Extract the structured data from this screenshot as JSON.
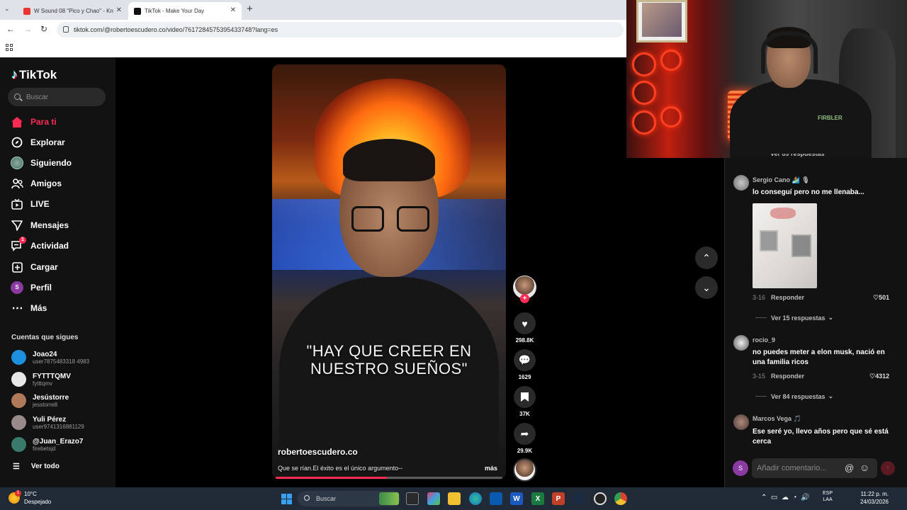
{
  "browser": {
    "tabs": [
      {
        "title": "W Sound 08 \"Pico y Chao\" - Kn"
      },
      {
        "title": "TikTok - Make Your Day"
      }
    ],
    "url": "tiktok.com/@robertoescudero.co/video/7617284575395433748?lang=es"
  },
  "sidebar": {
    "logo": "TikTok",
    "search_placeholder": "Buscar",
    "nav": [
      {
        "label": "Para ti",
        "icon": "home-icon"
      },
      {
        "label": "Explorar",
        "icon": "compass-icon"
      },
      {
        "label": "Siguiendo",
        "icon": "following-avatar-icon"
      },
      {
        "label": "Amigos",
        "icon": "friends-icon"
      },
      {
        "label": "LIVE",
        "icon": "live-icon"
      },
      {
        "label": "Mensajes",
        "icon": "messages-icon"
      },
      {
        "label": "Actividad",
        "icon": "activity-icon",
        "badge": "1"
      },
      {
        "label": "Cargar",
        "icon": "upload-icon"
      },
      {
        "label": "Perfil",
        "icon": "profile-avatar-icon"
      },
      {
        "label": "Más",
        "icon": "more-icon"
      }
    ],
    "following_title": "Cuentas que sigues",
    "accounts": [
      {
        "name": "Joao24",
        "username": "user7875483318 4983",
        "color": "#1e90e0"
      },
      {
        "name": "FYTTTQMV",
        "username": "fytttqmv",
        "color": "#e8e8e8"
      },
      {
        "name": "Jesústorre",
        "username": "jesstorre8",
        "color": "#b07a5a"
      },
      {
        "name": "Yuli Pérez",
        "username": "user9741316881129",
        "color": "#9a8a8a"
      },
      {
        "name": "@Juan_Erazo7",
        "username": "firebetsjd",
        "color": "#3a7a6a"
      }
    ],
    "see_all": "Ver todo"
  },
  "video": {
    "caption": "\"HAY QUE CREER EN NUESTRO SUEÑOS\"",
    "author": "robertoescudero.co",
    "description": "Que se rían.El éxito es el único argumento--",
    "more": "más",
    "progress": 0.49
  },
  "actions": {
    "likes": "298.8K",
    "comments": "1629",
    "saves": "37K",
    "shares": "29.9K"
  },
  "comments": {
    "cutoff_replies": "Ver 89 respuestas",
    "items": [
      {
        "user": "Sergio Cano 🏄 🎙",
        "text": "lo conseguí pero no me llenaba...",
        "date": "3-16",
        "reply": "Responder",
        "likes": "501",
        "replies": "Ver 15 respuestas"
      },
      {
        "user": "rocio_9",
        "text": "no puedes meter a elon musk, nació en una familia ricos",
        "date": "3-15",
        "reply": "Responder",
        "likes": "4312",
        "replies": "Ver 84 respuestas"
      },
      {
        "user": "Marcos Vega 🎵",
        "text": "Ese seré yo, llevo años pero que sé está cerca"
      }
    ],
    "input_placeholder": "Añadir comentario...",
    "my_avatar_letter": "S"
  },
  "webcam": {
    "shirt_text": "FIRBLER"
  },
  "taskbar": {
    "weather_temp": "10°C",
    "weather_desc": "Despejado",
    "weather_badge": "1",
    "search_placeholder": "Buscar",
    "lang_top": "ESP",
    "lang_bottom": "LAA",
    "time": "11:22 p. m.",
    "date": "24/03/2026"
  }
}
